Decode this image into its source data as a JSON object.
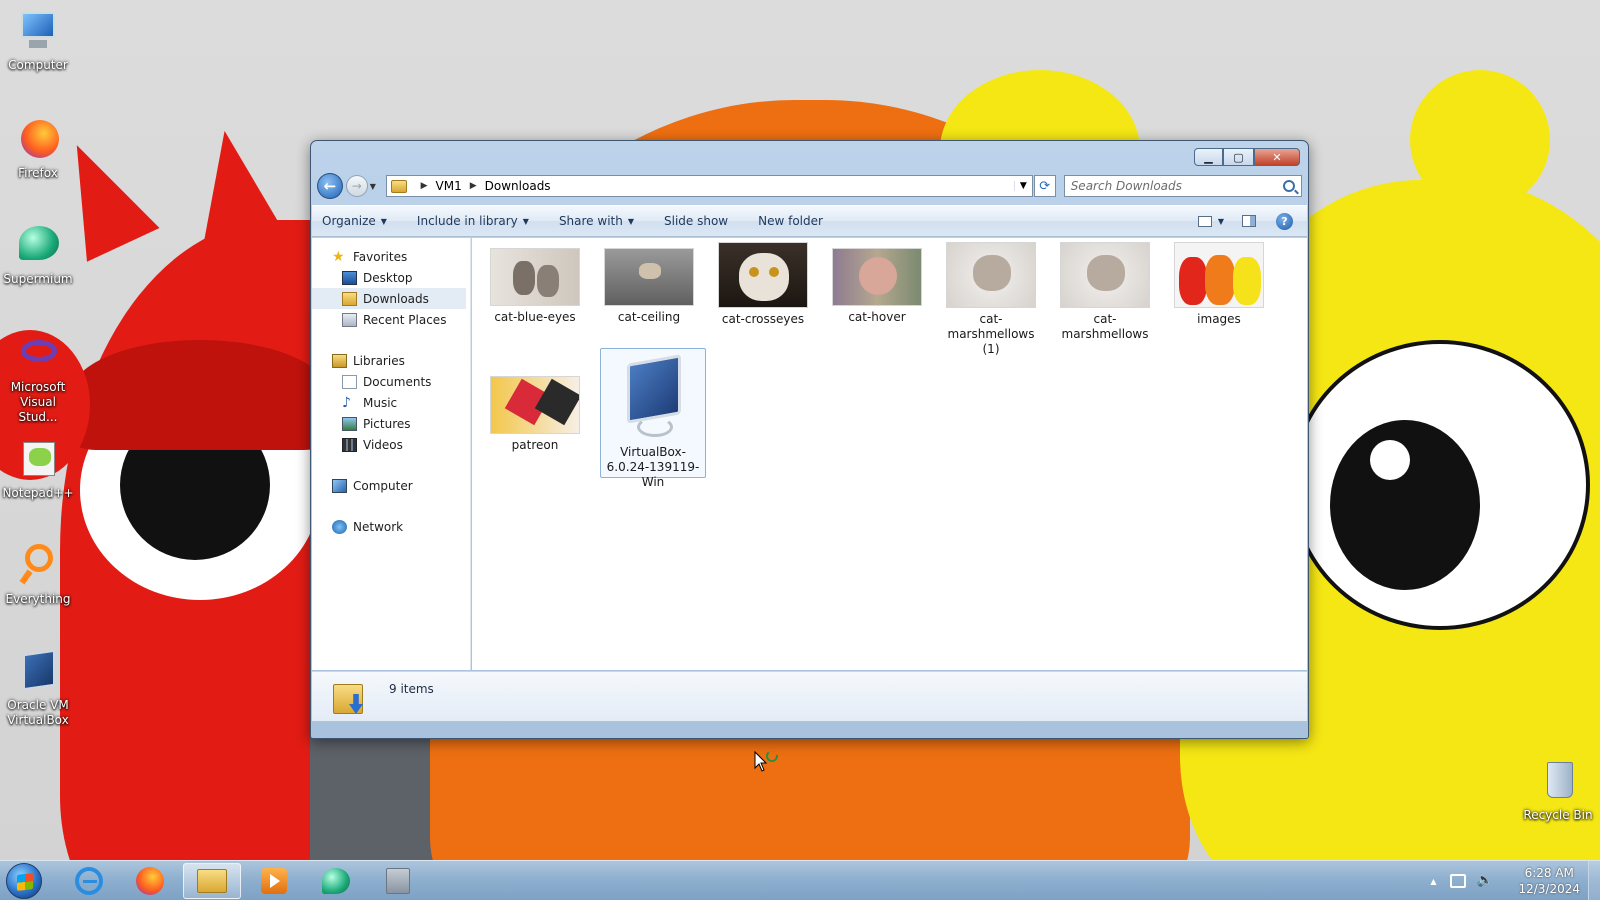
{
  "desktop": {
    "icons": [
      {
        "label": "Computer",
        "icon": "computer-icon"
      },
      {
        "label": "Firefox",
        "icon": "firefox-icon"
      },
      {
        "label": "Supermium",
        "icon": "supermium-icon"
      },
      {
        "label": "Microsoft Visual Stud...",
        "icon": "visual-studio-icon"
      },
      {
        "label": "Notepad++",
        "icon": "notepadpp-icon"
      },
      {
        "label": "Everything",
        "icon": "everything-icon"
      },
      {
        "label": "Oracle VM VirtualBox",
        "icon": "virtualbox-icon"
      }
    ],
    "recycle_bin": "Recycle Bin"
  },
  "explorer": {
    "breadcrumb": [
      "VM1",
      "Downloads"
    ],
    "search_placeholder": "Search Downloads",
    "toolbar": {
      "organize": "Organize",
      "include_in_library": "Include in library",
      "share_with": "Share with",
      "slide_show": "Slide show",
      "new_folder": "New folder"
    },
    "nav": {
      "favorites": "Favorites",
      "desktop": "Desktop",
      "downloads": "Downloads",
      "recent_places": "Recent Places",
      "libraries": "Libraries",
      "documents": "Documents",
      "music": "Music",
      "pictures": "Pictures",
      "videos": "Videos",
      "computer": "Computer",
      "network": "Network"
    },
    "files": [
      {
        "name": "cat-blue-eyes"
      },
      {
        "name": "cat-ceiling"
      },
      {
        "name": "cat-crosseyes"
      },
      {
        "name": "cat-hover"
      },
      {
        "name": "cat-marshmellows (1)"
      },
      {
        "name": "cat-marshmellows"
      },
      {
        "name": "images"
      },
      {
        "name": "patreon"
      },
      {
        "name": "VirtualBox-6.0.24-139119-Win",
        "selected": true
      }
    ],
    "status": "9 items"
  },
  "taskbar": {
    "apps": [
      "internet-explorer-icon",
      "firefox-icon",
      "windows-explorer-icon",
      "media-player-icon",
      "supermium-icon",
      "app-icon"
    ],
    "active_app": "windows-explorer-icon",
    "time": "6:28 AM",
    "date": "12/3/2024"
  },
  "colors": {
    "taskbar": "#8fb0cf",
    "window_frame": "#bcd3ea",
    "selection": "#cce8ff"
  }
}
